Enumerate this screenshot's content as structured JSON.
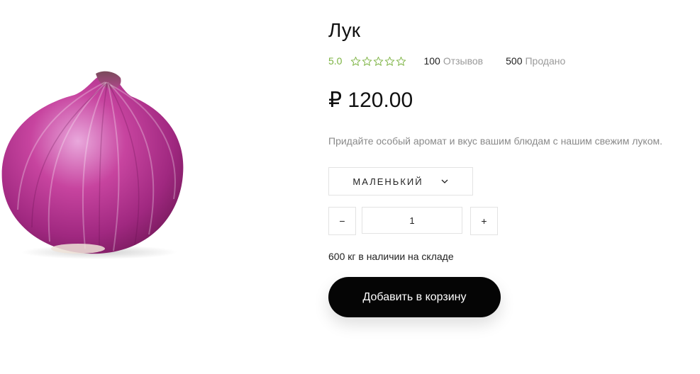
{
  "product": {
    "image_icon": "red-onion-image",
    "title": "Лук",
    "rating": {
      "value": "5.0",
      "stars_filled": 0,
      "stars_total": 5
    },
    "reviews": {
      "count": "100",
      "label": "Отзывов"
    },
    "sold": {
      "count": "500",
      "label": "Продано"
    },
    "price": "₽ 120.00",
    "description": "Придайте особый аромат и вкус вашим блюдам с нашим свежим луком.",
    "size_select": {
      "selected": "МАЛЕНЬКИЙ",
      "icon": "chevron-down-icon"
    },
    "quantity": {
      "minus": "−",
      "value": "1",
      "plus": "+"
    },
    "stock": "600 кг в наличии на складе",
    "add_to_cart": "Добавить в корзину"
  },
  "colors": {
    "rating": "#7cb342",
    "muted": "#9a9a9a",
    "button_bg": "#050505",
    "border": "#e3e3e3"
  }
}
